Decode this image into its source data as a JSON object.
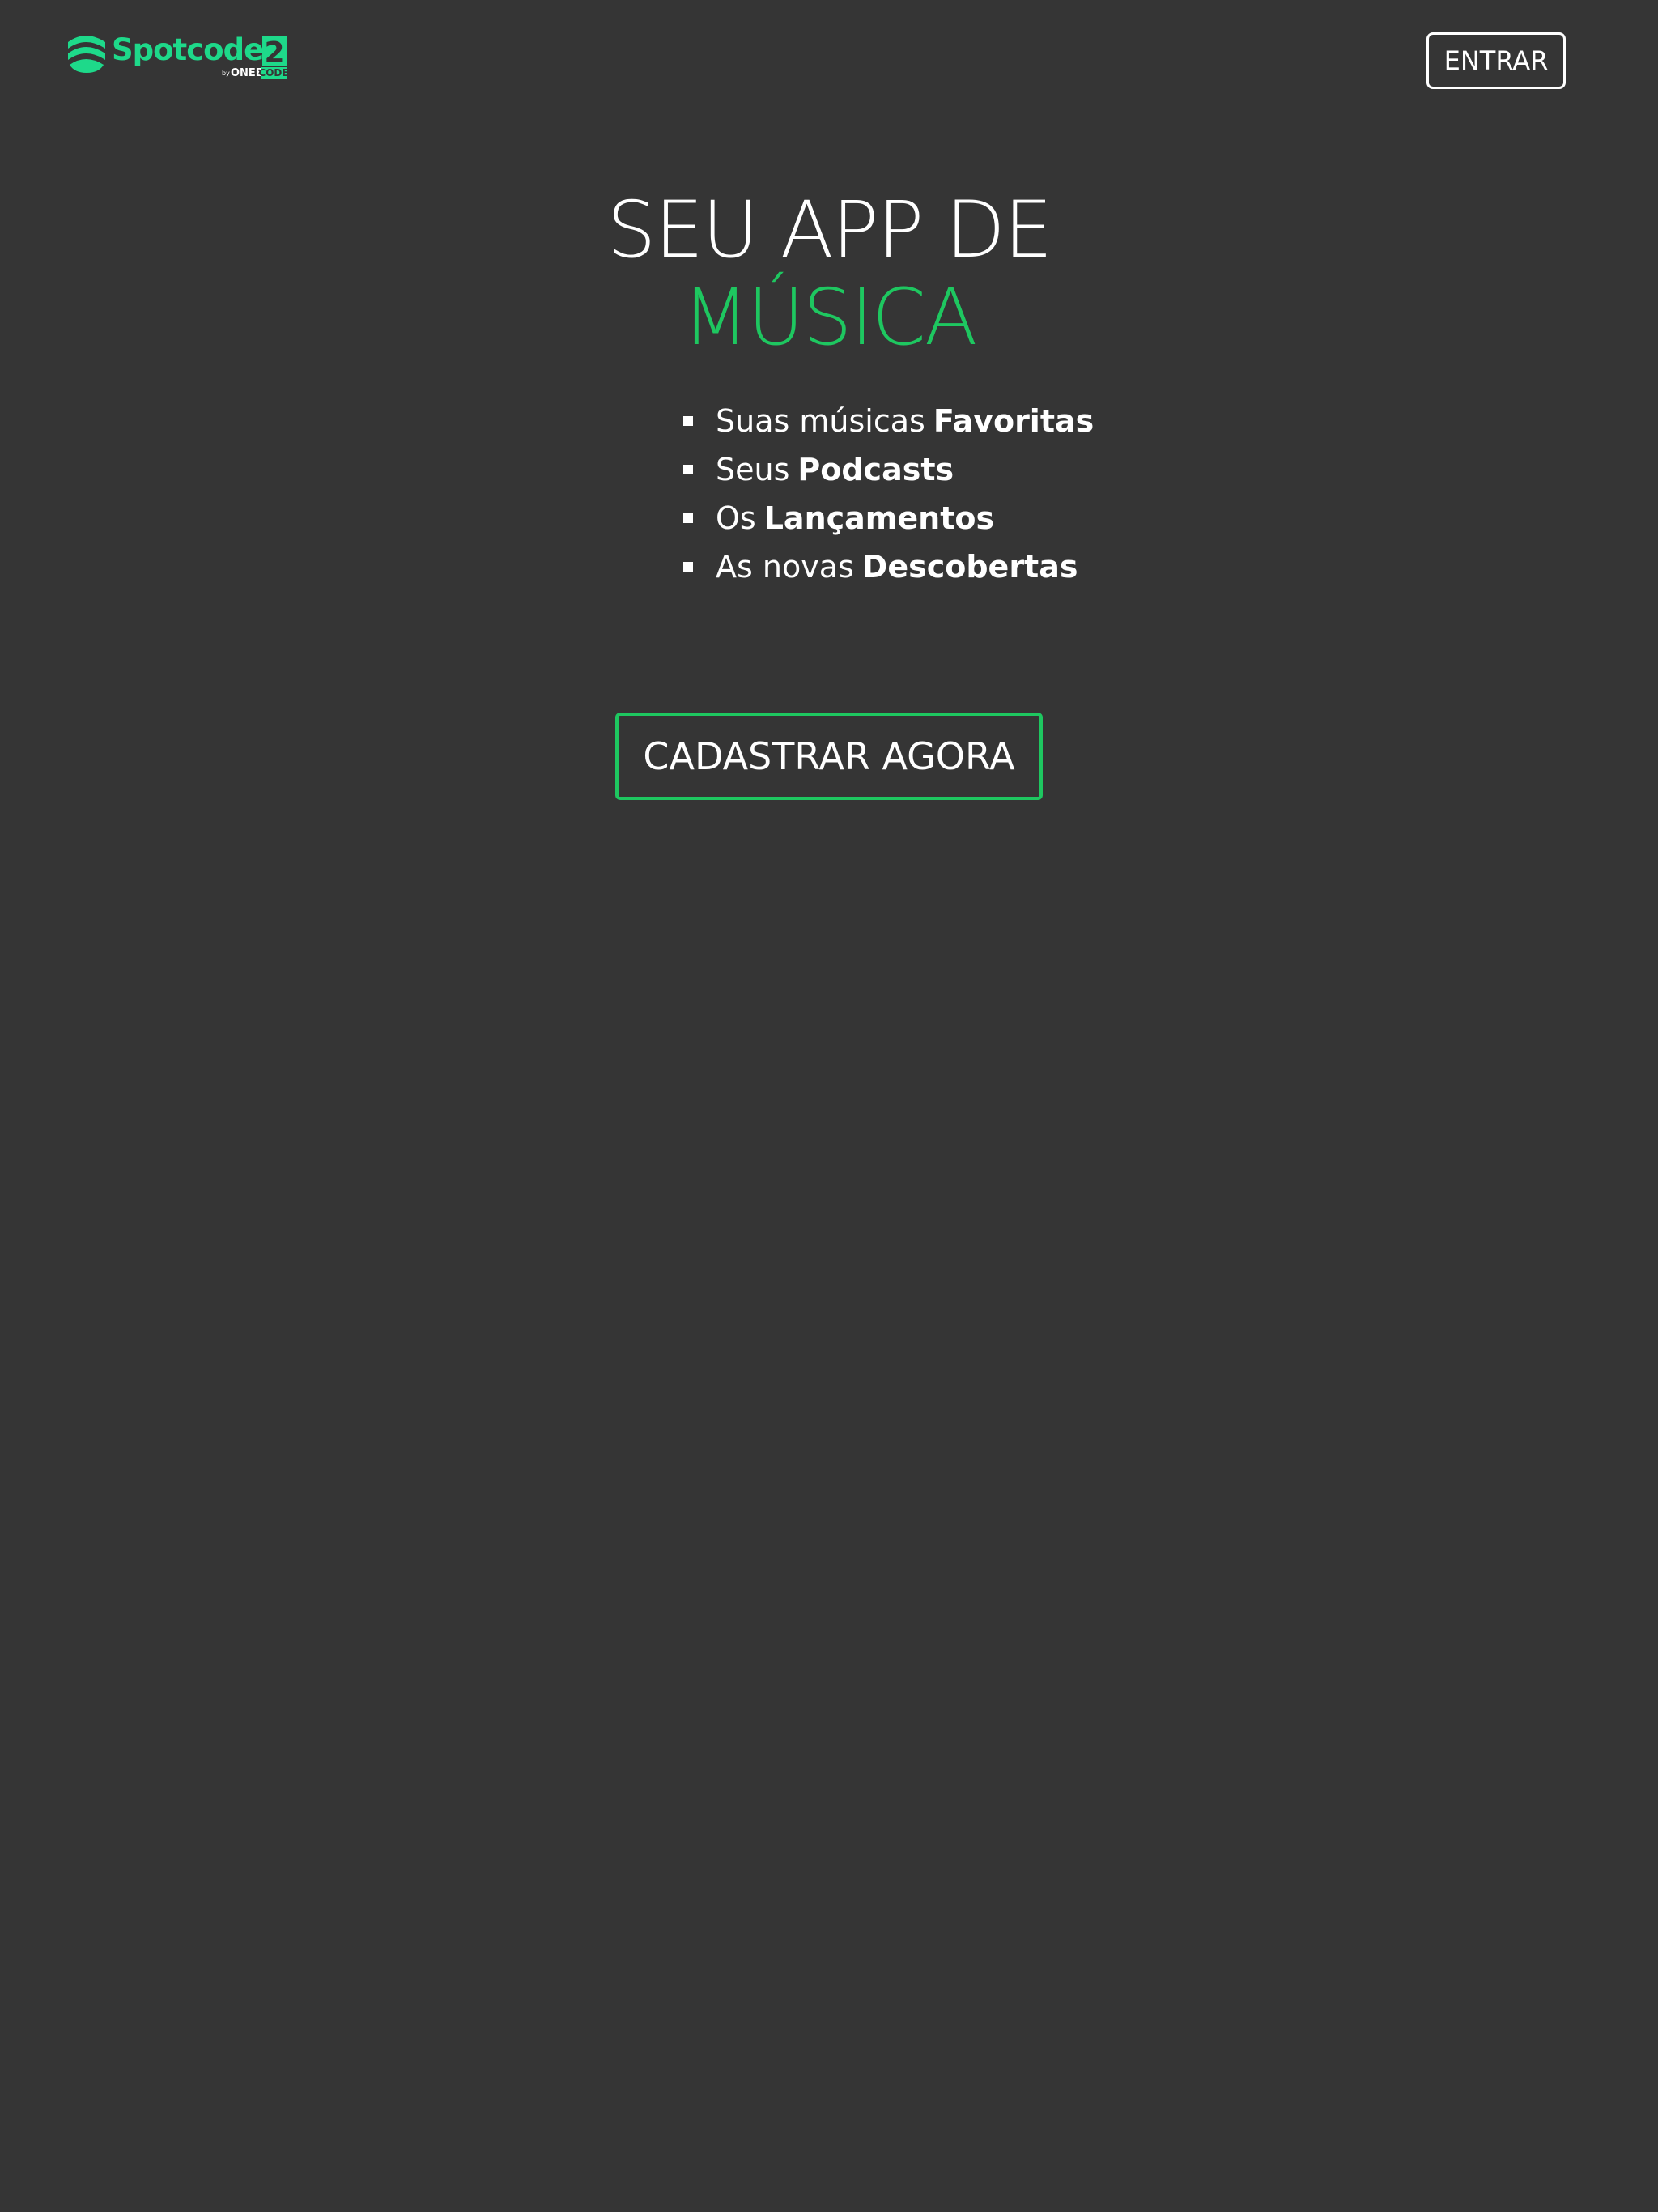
{
  "header": {
    "logo": {
      "brand_text": "Spotcode",
      "version_text": "2",
      "byline_prefix": "by",
      "byline_brand": "ONEBIT",
      "byline_brand_suffix": "CODE",
      "icon": "sound-waves-icon"
    },
    "login_label": "ENTRAR"
  },
  "hero": {
    "line1": "SEU APP DE",
    "line2": "MÚSICA"
  },
  "features": [
    {
      "prefix": "Suas músicas",
      "highlight": "Favoritas"
    },
    {
      "prefix": "Seus",
      "highlight": "Podcasts"
    },
    {
      "prefix": "Os",
      "highlight": "Lançamentos"
    },
    {
      "prefix": "As novas",
      "highlight": "Descobertas"
    }
  ],
  "cta": {
    "label": "CADASTRAR AGORA"
  },
  "colors": {
    "background": "#353535",
    "accent": "#1ec760",
    "logo_green": "#1ed98a",
    "text": "#ffffff"
  }
}
